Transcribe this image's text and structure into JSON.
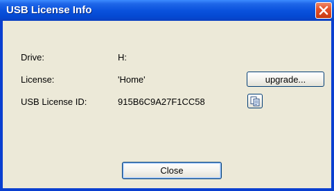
{
  "window": {
    "title": "USB License Info"
  },
  "fields": [
    {
      "label": "Drive:",
      "value": "H:"
    },
    {
      "label": "License:",
      "value": "'Home'"
    },
    {
      "label": "USB License ID:",
      "value": "915B6C9A27F1CC58"
    }
  ],
  "buttons": {
    "upgrade_label": "upgrade...",
    "close_label": "Close"
  },
  "icons": {
    "title_close": "close-icon",
    "copy": "copy-icon"
  },
  "colors": {
    "titlebar": "#0a52dd",
    "client_bg": "#ece9d8",
    "close_button": "#e4502a"
  }
}
